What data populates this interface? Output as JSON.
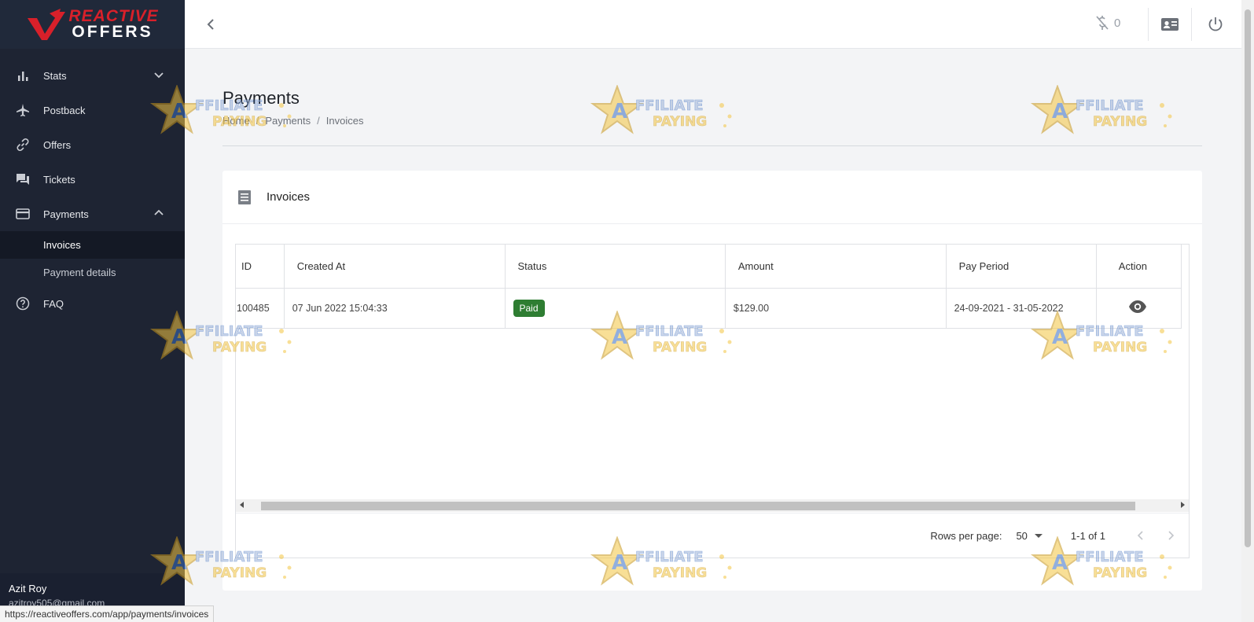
{
  "brand": {
    "logo_top": "REACTIVE",
    "logo_bottom": "OFFERS",
    "accent": "#d8202a"
  },
  "sidebar": {
    "items": [
      {
        "label": "Stats",
        "icon": "bar-chart-icon"
      },
      {
        "label": "Postback",
        "icon": "airplane-icon"
      },
      {
        "label": "Offers",
        "icon": "link-icon"
      },
      {
        "label": "Tickets",
        "icon": "forum-icon"
      },
      {
        "label": "Payments",
        "icon": "credit-card-icon"
      },
      {
        "label": "FAQ",
        "icon": "help-circle-icon"
      }
    ],
    "payments_sub": [
      {
        "label": "Invoices",
        "active": true
      },
      {
        "label": "Payment details",
        "active": false
      }
    ],
    "user": {
      "name": "Azit Roy",
      "email": "azitroy505@gmail.com"
    }
  },
  "topbar": {
    "balance": "0"
  },
  "page": {
    "title": "Payments",
    "breadcrumb": [
      "Home",
      "Payments",
      "Invoices"
    ]
  },
  "card": {
    "title": "Invoices",
    "columns": [
      "ID",
      "Created At",
      "Status",
      "Amount",
      "Pay Period",
      "Action"
    ],
    "rows": [
      {
        "id": "100485",
        "created_at": "07 Jun 2022 15:04:33",
        "status": "Paid",
        "amount": "$129.00",
        "pay_period": "24-09-2021 - 31-05-2022"
      }
    ],
    "status_color": "#2e7d32",
    "pagination": {
      "rows_per_page_label": "Rows per page:",
      "rows_per_page": "50",
      "range": "1-1 of 1"
    }
  },
  "status_bar": {
    "url": "https://reactiveoffers.com/app/payments/invoices"
  },
  "watermark": {
    "line1": "AFFILIATE",
    "line2": "PAYING"
  }
}
